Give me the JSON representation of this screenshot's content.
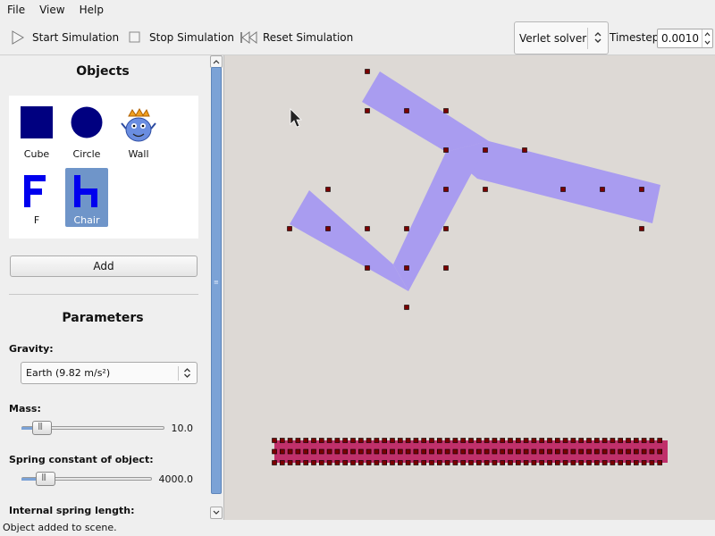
{
  "menu": {
    "file": "File",
    "view": "View",
    "help": "Help"
  },
  "toolbar": {
    "start_label": "Start Simulation",
    "stop_label": "Stop Simulation",
    "reset_label": "Reset Simulation",
    "solver_value": "Verlet solver",
    "timestep_label": "Timestep",
    "timestep_value": "0.0010"
  },
  "objects": {
    "title": "Objects",
    "items": [
      {
        "label": "Cube",
        "icon": "cube-icon"
      },
      {
        "label": "Circle",
        "icon": "circle-icon"
      },
      {
        "label": "Wall",
        "icon": "wall-icon"
      },
      {
        "label": "F",
        "icon": "f-shape-icon"
      },
      {
        "label": "Chair",
        "icon": "chair-shape-icon",
        "selected": true
      }
    ],
    "add_label": "Add"
  },
  "parameters": {
    "title": "Parameters",
    "gravity_label": "Gravity:",
    "gravity_value": "Earth (9.82 m/s²)",
    "mass_label": "Mass:",
    "mass_value": "10.0",
    "spring_label": "Spring constant of object:",
    "spring_value": "4000.0",
    "internal_label": "Internal spring length:"
  },
  "colors": {
    "chair": "#a99cf0",
    "wall": "#c0306a",
    "node": "#7a0000",
    "canvas": "#ddd9d5",
    "selection": "#6f95c9"
  },
  "status": {
    "text": "Object added to scene."
  }
}
